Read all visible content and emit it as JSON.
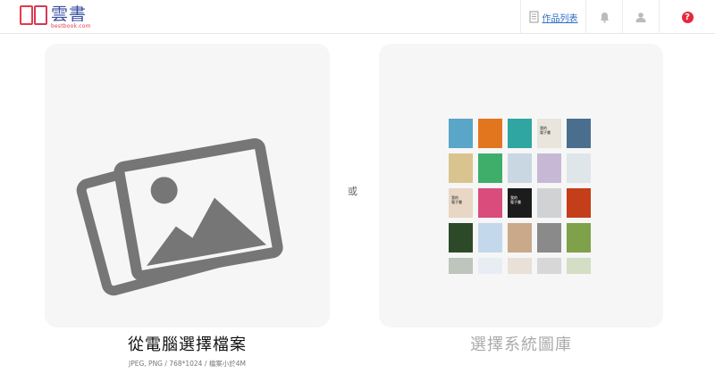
{
  "header": {
    "logo_text": "雲書",
    "logo_sub": "bestbook.com",
    "works_label": "作品列表",
    "help_symbol": "?",
    "icons": [
      "book-icon",
      "bell-icon",
      "user-icon",
      "help-icon"
    ]
  },
  "upload": {
    "title": "從電腦選擇檔案",
    "subtitle": "JPEG, PNG / 768*1024 / 檔案小於4M"
  },
  "separator": "或",
  "library": {
    "title": "選擇系統圖庫",
    "covers": [
      [
        {
          "c": "#5aa6c8",
          "t": ""
        },
        {
          "c": "#e2761f",
          "t": ""
        },
        {
          "c": "#2fa6a1",
          "t": ""
        },
        {
          "c": "#e9e4dc",
          "t": "我的\n電子書"
        },
        {
          "c": "#4a6f8e",
          "t": ""
        }
      ],
      [
        {
          "c": "#d9c48f",
          "t": ""
        },
        {
          "c": "#3fae6a",
          "t": ""
        },
        {
          "c": "#c9d7e2",
          "t": ""
        },
        {
          "c": "#c7b9d6",
          "t": ""
        },
        {
          "c": "#dfe6ea",
          "t": ""
        }
      ],
      [
        {
          "c": "#e7d7c4",
          "t": "我的\n電子書"
        },
        {
          "c": "#d94c7c",
          "t": ""
        },
        {
          "c": "#1c1c1c",
          "t": "我的\n電子書"
        },
        {
          "c": "#d0d2d4",
          "t": ""
        },
        {
          "c": "#c43e1a",
          "t": ""
        }
      ],
      [
        {
          "c": "#2d4a28",
          "t": ""
        },
        {
          "c": "#c4d8ec",
          "t": ""
        },
        {
          "c": "#c9a98a",
          "t": ""
        },
        {
          "c": "#8a8a8a",
          "t": ""
        },
        {
          "c": "#7ea14a",
          "t": ""
        }
      ]
    ],
    "colors": {
      "accent": "#e8394b",
      "link": "#2f6fc4"
    }
  }
}
